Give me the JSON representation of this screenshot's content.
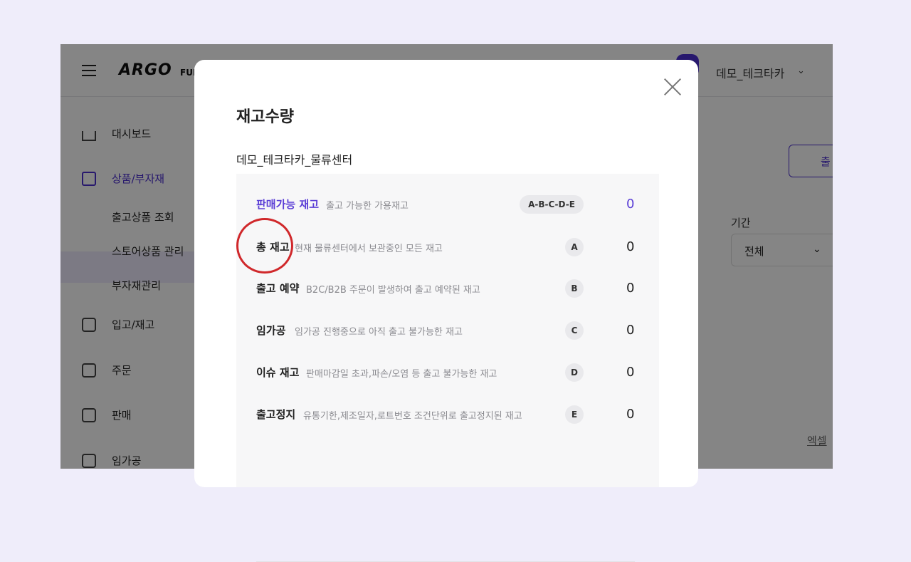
{
  "app": {
    "logo": "ARGO",
    "logo_sub": "FUL",
    "user_name": "데모_테크타카",
    "sidebar": {
      "items": [
        {
          "label": "대시보드",
          "icon": "house-icon"
        },
        {
          "label": "상품/부자재",
          "icon": "shopping-bag-icon"
        },
        {
          "label": "입고/재고",
          "icon": "warehouse-icon"
        },
        {
          "label": "주문",
          "icon": "order-document-icon"
        },
        {
          "label": "판매",
          "icon": "store-icon"
        },
        {
          "label": "임가공",
          "icon": "inbox-icon"
        }
      ],
      "sub_items": [
        "출고상품 조회",
        "스토어상품 관리",
        "부자재관리"
      ]
    },
    "right_button": "출",
    "period_label": "기간",
    "period_value": "전체",
    "excel_link": "엑셀"
  },
  "modal": {
    "title": "재고수량",
    "center_name": "데모_테크타카_물류센터",
    "rows": [
      {
        "name": "판매가능 재고",
        "desc": "출고 가능한 가용재고",
        "badge": "A-B-C-D-E",
        "value": "0"
      },
      {
        "name": "총 재고",
        "desc": "현재 물류센터에서 보관중인 모든 재고",
        "badge": "A",
        "value": "0"
      },
      {
        "name": "출고 예약",
        "desc": "B2C/B2B 주문이 발생하여 출고 예약된 재고",
        "badge": "B",
        "value": "0"
      },
      {
        "name": "임가공",
        "desc": "임가공 진행중으로 아직 출고 불가능한 재고",
        "badge": "C",
        "value": "0"
      },
      {
        "name": "이슈 재고",
        "desc": "판매마감일 초과,파손/오염 등 출고 불가능한 재고",
        "badge": "D",
        "value": "0"
      },
      {
        "name": "출고정지",
        "desc": "유통기한,제조일자,로트번호 조건단위로 출고정지된 재고",
        "badge": "E",
        "value": "0"
      }
    ]
  },
  "colors": {
    "accent": "#4b2fd1",
    "highlight": "#5b3fd6",
    "annotation": "#d0282b"
  }
}
